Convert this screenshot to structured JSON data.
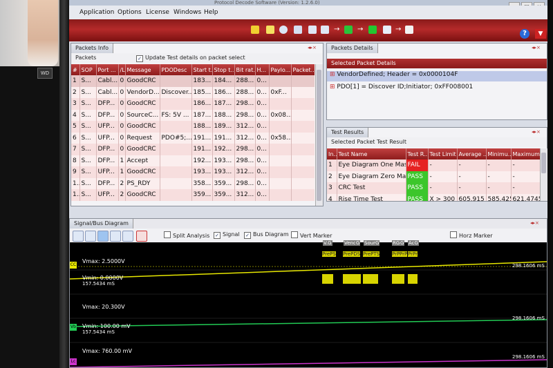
{
  "app": {
    "title_fragment": "Protocol Decode Software (Version: 1.2.6.0)"
  },
  "window_controls": [
    "–",
    "□",
    "×"
  ],
  "menu": [
    {
      "label": "Application"
    },
    {
      "label": "Options"
    },
    {
      "label": "License"
    },
    {
      "label": "Windows"
    },
    {
      "label": "Help"
    }
  ],
  "toolbar": {
    "help_label": "?",
    "dropdown_label": "▼"
  },
  "packets_info": {
    "tab": "Packets Info",
    "band_label": "Packets",
    "update_checkbox": "Update Test details on packet select",
    "columns": [
      "#",
      "SOP",
      "Port ...",
      "/L",
      "Message",
      "PDODesc",
      "Start t...",
      "Stop t...",
      "Bit rat...",
      "H...",
      "Paylo...",
      "Packet..."
    ],
    "rows": [
      [
        "1",
        "S...",
        "Cabl...",
        "0",
        "GoodCRC",
        "",
        "183...",
        "184...",
        "288...",
        "0...",
        "",
        ""
      ],
      [
        "2",
        "S...",
        "Cabl...",
        "0",
        "VendorD...",
        "Discover...",
        "185...",
        "186...",
        "288...",
        "0...",
        "0xF...",
        ""
      ],
      [
        "3",
        "S...",
        "DFP...",
        "0",
        "GoodCRC",
        "",
        "186...",
        "187...",
        "298...",
        "0...",
        "",
        ""
      ],
      [
        "4",
        "S...",
        "DFP...",
        "0",
        "SourceC...",
        "FS: 5V ...",
        "187...",
        "188...",
        "298...",
        "0...",
        "0x08...",
        ""
      ],
      [
        "5",
        "S...",
        "UFP...",
        "0",
        "GoodCRC",
        "",
        "188...",
        "189...",
        "312...",
        "0...",
        "",
        ""
      ],
      [
        "6",
        "S...",
        "UFP...",
        "0",
        "Request",
        "PDO#5;...",
        "191...",
        "191...",
        "312...",
        "0...",
        "0x58...",
        ""
      ],
      [
        "7",
        "S...",
        "DFP...",
        "0",
        "GoodCRC",
        "",
        "191...",
        "192...",
        "298...",
        "0...",
        "",
        ""
      ],
      [
        "8",
        "S...",
        "DFP...",
        "1",
        "Accept",
        "",
        "192...",
        "193...",
        "298...",
        "0...",
        "",
        ""
      ],
      [
        "9",
        "S...",
        "UFP...",
        "1",
        "GoodCRC",
        "",
        "193...",
        "193...",
        "312...",
        "0...",
        "",
        ""
      ],
      [
        "1...",
        "S...",
        "DFP...",
        "2",
        "PS_RDY",
        "",
        "358...",
        "359...",
        "298...",
        "0...",
        "",
        ""
      ],
      [
        "1...",
        "S...",
        "UFP...",
        "2",
        "GoodCRC",
        "",
        "359...",
        "359...",
        "312...",
        "0...",
        "",
        ""
      ]
    ]
  },
  "packet_details": {
    "tab": "Packets Details",
    "band_label": "Selected Packet Details",
    "items": [
      "VendorDefined; Header = 0x0000104F",
      "PDO[1] = Discover ID;Initiator; 0xFF008001"
    ]
  },
  "test_results": {
    "tab": "Test Results",
    "band_label": "Selected Packet Test Result",
    "columns": [
      "In...",
      "Test Name",
      "Test R...",
      "Test Limit",
      "Average ...",
      "Minimu...",
      "Maximum..."
    ],
    "rows": [
      [
        "1",
        "Eye Diagram One Mas...",
        "FAIL",
        "-",
        "-",
        "-",
        "-"
      ],
      [
        "2",
        "Eye Diagram Zero Mas...",
        "PASS",
        "-",
        "-",
        "-",
        "-"
      ],
      [
        "3",
        "CRC Test",
        "PASS",
        "-",
        "-",
        "-",
        "-"
      ],
      [
        "4",
        "Rise Time Test",
        "PASS",
        "X > 300 ns",
        "605.915 ...",
        "585.425 ...",
        "621.4745 ..."
      ]
    ]
  },
  "signal": {
    "tab": "Signal/Bus Diagram",
    "checkboxes": [
      {
        "label": "Split Analysis",
        "checked": false
      },
      {
        "label": "Signal",
        "checked": true
      },
      {
        "label": "Bus Diagram",
        "checked": true
      },
      {
        "label": "Vert Marker",
        "checked": false
      }
    ],
    "horz_marker": "Horz Marker",
    "channels": [
      {
        "tag": "CC",
        "vmax": "Vmax: 2.5000V",
        "vmin": "Vmin: 0.0000V",
        "time_left": "157.5434 mS",
        "time_right": "298.1606 mS",
        "color": "#e8e800"
      },
      {
        "tag": "Vb",
        "vmax": "Vmax: 20.300V",
        "vmin": "Vmin: 100.00 mV",
        "time_left": "157.5434 mS",
        "time_right": "298.1606 mS",
        "color": "#22cc55"
      },
      {
        "tag": "Lc",
        "vmax": "Vmax: 760.00 mV",
        "vmin": "",
        "time_left": "",
        "time_right": "298.1606 mS",
        "color": "#cc33cc"
      }
    ],
    "bus_labels": [
      {
        "top": "V.G",
        "bottom": "PrePS"
      },
      {
        "top": "Vend",
        "bottom": "PrePDS"
      },
      {
        "top": "G",
        "bottom": ""
      },
      {
        "top": "SourG",
        "bottom": "PrePTS"
      },
      {
        "top": "RG",
        "bottom": "PrP"
      },
      {
        "top": "G",
        "bottom": "PrP"
      },
      {
        "top": "AcG",
        "bottom": "PrPr"
      }
    ]
  },
  "colors": {
    "accent_red": "#9a1f1f",
    "pass": "#3cc62b",
    "fail": "#e62222",
    "cc_line": "#e8e800",
    "vbus_line": "#22cc55",
    "lc_line": "#cc33cc"
  }
}
